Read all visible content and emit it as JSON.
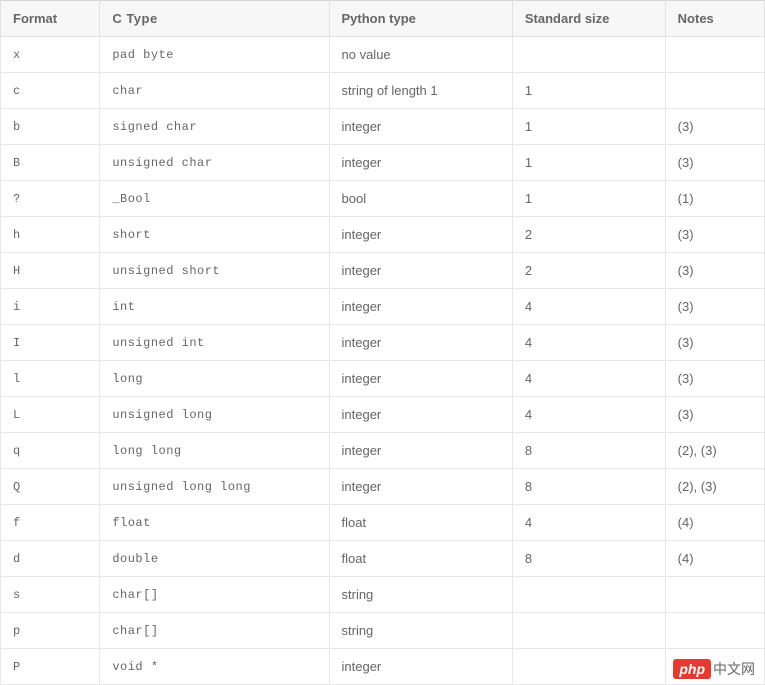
{
  "headers": [
    "Format",
    "C Type",
    "Python type",
    "Standard size",
    "Notes"
  ],
  "rows": [
    {
      "format": "x",
      "ctype": "pad byte",
      "python": "no value",
      "size": "",
      "notes": ""
    },
    {
      "format": "c",
      "ctype": "char",
      "python": "string of length 1",
      "size": "1",
      "notes": ""
    },
    {
      "format": "b",
      "ctype": "signed  char",
      "python": "integer",
      "size": "1",
      "notes": "(3)"
    },
    {
      "format": "B",
      "ctype": "unsigned  char",
      "python": "integer",
      "size": "1",
      "notes": "(3)"
    },
    {
      "format": "?",
      "ctype": "_Bool",
      "python": "bool",
      "size": "1",
      "notes": "(1)"
    },
    {
      "format": "h",
      "ctype": "short",
      "python": "integer",
      "size": "2",
      "notes": "(3)"
    },
    {
      "format": "H",
      "ctype": "unsigned  short",
      "python": "integer",
      "size": "2",
      "notes": "(3)"
    },
    {
      "format": "i",
      "ctype": "int",
      "python": "integer",
      "size": "4",
      "notes": "(3)"
    },
    {
      "format": "I",
      "ctype": "unsigned  int",
      "python": "integer",
      "size": "4",
      "notes": "(3)"
    },
    {
      "format": "l",
      "ctype": "long",
      "python": "integer",
      "size": "4",
      "notes": "(3)"
    },
    {
      "format": "L",
      "ctype": "unsigned  long",
      "python": "integer",
      "size": "4",
      "notes": "(3)"
    },
    {
      "format": "q",
      "ctype": "long  long",
      "python": "integer",
      "size": "8",
      "notes": "(2), (3)"
    },
    {
      "format": "Q",
      "ctype": "unsigned  long  long",
      "python": "integer",
      "size": "8",
      "notes": "(2), (3)"
    },
    {
      "format": "f",
      "ctype": "float",
      "python": "float",
      "size": "4",
      "notes": "(4)"
    },
    {
      "format": "d",
      "ctype": "double",
      "python": "float",
      "size": "8",
      "notes": "(4)"
    },
    {
      "format": "s",
      "ctype": "char[]",
      "python": "string",
      "size": "",
      "notes": ""
    },
    {
      "format": "p",
      "ctype": "char[]",
      "python": "string",
      "size": "",
      "notes": ""
    },
    {
      "format": "P",
      "ctype": "void  *",
      "python": "integer",
      "size": "",
      "notes": ""
    }
  ],
  "watermark": {
    "badge": "php",
    "text": "中文网"
  }
}
